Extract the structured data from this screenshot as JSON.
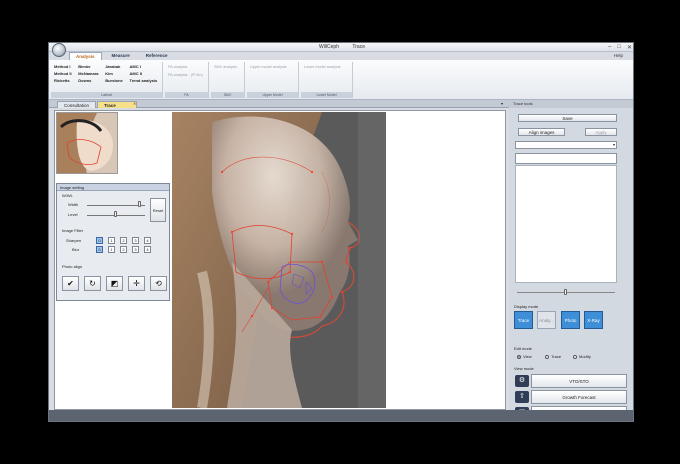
{
  "window": {
    "title_app": "WillCeph",
    "title_doc": "Trace",
    "min": "–",
    "max": "□",
    "close": "✕"
  },
  "ribbon": {
    "tabs": [
      "Analysis",
      "Measure",
      "Reference"
    ],
    "help": "Help",
    "analysis_grid": [
      [
        "Method I",
        "Bimler",
        "Jarabak",
        "AMC I"
      ],
      [
        "Method II",
        "McNamara",
        "Kim",
        "AMC II"
      ],
      [
        "Ricketts",
        "Downs",
        "Burstone",
        "Trend analysis"
      ]
    ],
    "analysis_label": "Lateral",
    "pa_items": [
      "PA analysis",
      "PA analysis · (PI lim)"
    ],
    "pa_label": "PA",
    "smv_items": [
      "SMV analysis"
    ],
    "smv_label": "SMV",
    "upper_items": [
      "Upper model analysis"
    ],
    "upper_label": "Upper Model",
    "lower_items": [
      "Lower model analysis"
    ],
    "lower_label": "Lower Model"
  },
  "doctabs": {
    "consultation": "Consultation",
    "trace": "Trace",
    "close_glyph": "✕",
    "chevron": "▾"
  },
  "right_panel": {
    "title": "Trace tools",
    "save": "Save",
    "align_images": "Align images",
    "apply": "Apply",
    "display_mode_label": "Display mode",
    "display_modes": [
      "Trace",
      "Analy...",
      "Photo",
      "X-Ray"
    ],
    "edit_mode_label": "Edit mode",
    "edit_modes": [
      "View",
      "Trace",
      "Modify"
    ],
    "view_mode_label": "View mode",
    "view_modes": [
      "VTO/STO",
      "Growth Forecast",
      "Super Impose",
      "Chart",
      "Gallery"
    ]
  },
  "image_setting": {
    "title": "Image setting",
    "wwl": "W/WL",
    "width": "Width",
    "level": "Level",
    "reset": "Reset",
    "image_filter": "Image Filter",
    "sharpen": "Sharpen",
    "blur": "Blur",
    "filter_levels": [
      "0",
      "1",
      "2",
      "3",
      "4"
    ],
    "sharpen_level": 0,
    "blur_level": 0,
    "width_level": 0.92,
    "level_level": 0.5,
    "photo_align": "Photo align",
    "tools": [
      "check-icon",
      "rotate-icon",
      "crop-icon",
      "move-icon",
      "refresh-icon"
    ]
  },
  "colors": {
    "accent": "#3f8fd8",
    "trace_red": "#e0412e",
    "trace_purple": "#6c4fd8"
  }
}
